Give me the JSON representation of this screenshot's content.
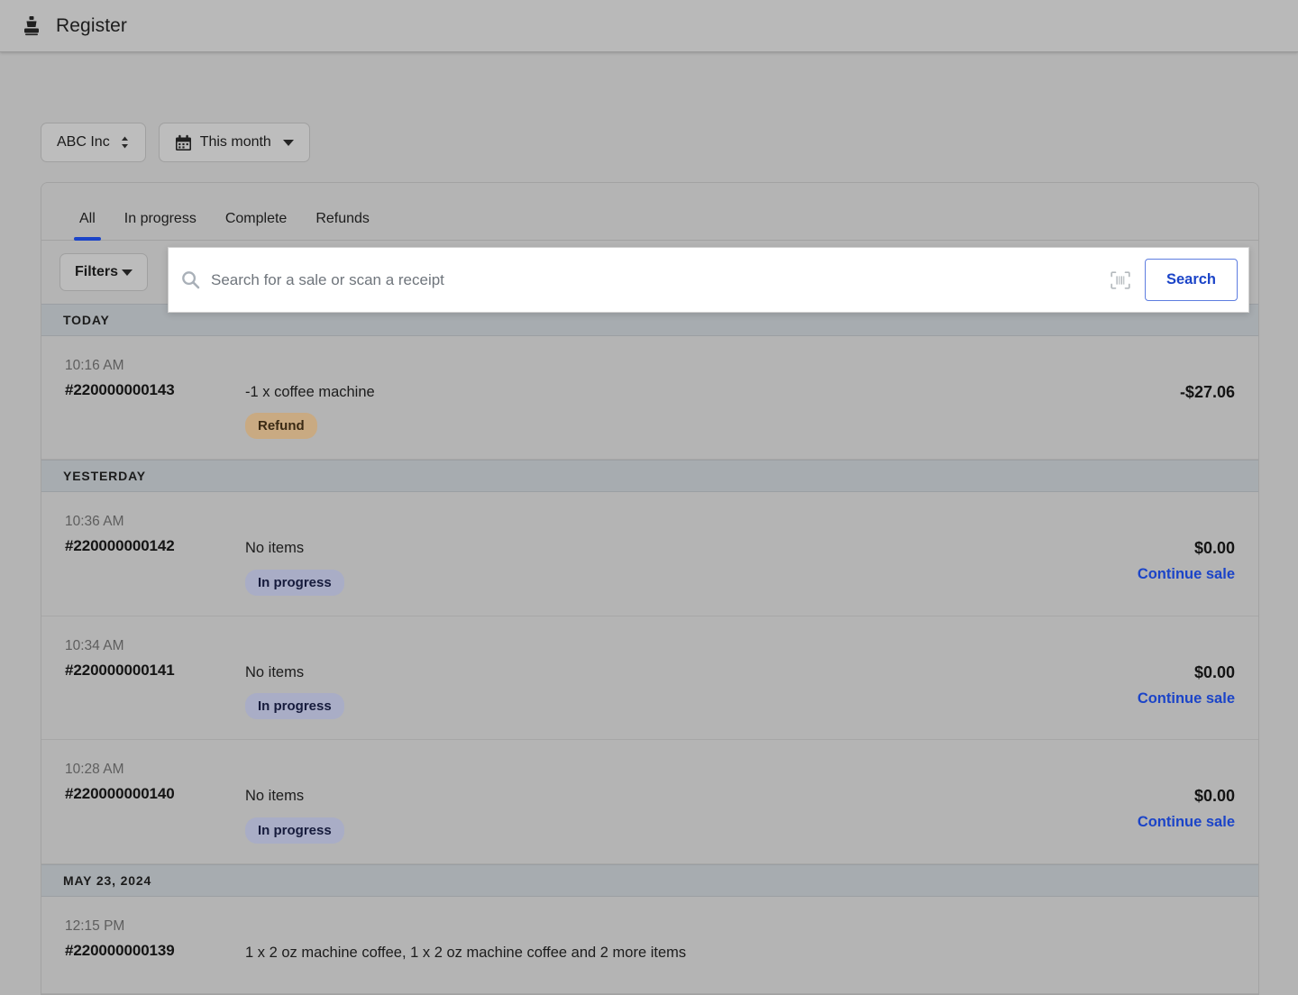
{
  "header": {
    "title": "Register",
    "icon": "register-stamp-icon"
  },
  "toolbar": {
    "entity": {
      "label": "ABC Inc",
      "icon": "up-down-chevron-icon"
    },
    "date_range": {
      "label": "This month",
      "icon": "calendar-icon",
      "caret": "chevron-down-icon"
    }
  },
  "tabs": [
    {
      "label": "All",
      "active": true
    },
    {
      "label": "In progress",
      "active": false
    },
    {
      "label": "Complete",
      "active": false
    },
    {
      "label": "Refunds",
      "active": false
    }
  ],
  "filters": {
    "label": "Filters",
    "caret": "chevron-down-icon"
  },
  "search": {
    "placeholder": "Search for a sale or scan a receipt",
    "value": "",
    "glass_icon": "search-icon",
    "barcode_icon": "barcode-scan-icon",
    "submit_label": "Search"
  },
  "accent_colors": {
    "link": "#1b44c8",
    "tab_underline": "#1b44c8",
    "refund_badge_bg": "#c9aa82",
    "inprogress_badge_bg": "#a9adc6",
    "day_header_bg": "#a7acb0",
    "card_bg": "#b4b4b4"
  },
  "groups": [
    {
      "day": "TODAY",
      "transactions": [
        {
          "time": "10:16 AM",
          "id": "#220000000143",
          "items": "-1 x coffee machine",
          "badge": "Refund",
          "badge_type": "refund",
          "amount": "-$27.06",
          "action": ""
        }
      ]
    },
    {
      "day": "YESTERDAY",
      "transactions": [
        {
          "time": "10:36 AM",
          "id": "#220000000142",
          "items": "No items",
          "badge": "In progress",
          "badge_type": "inprogress",
          "amount": "$0.00",
          "action": "Continue sale"
        },
        {
          "time": "10:34 AM",
          "id": "#220000000141",
          "items": "No items",
          "badge": "In progress",
          "badge_type": "inprogress",
          "amount": "$0.00",
          "action": "Continue sale"
        },
        {
          "time": "10:28 AM",
          "id": "#220000000140",
          "items": "No items",
          "badge": "In progress",
          "badge_type": "inprogress",
          "amount": "$0.00",
          "action": "Continue sale"
        }
      ]
    },
    {
      "day": "MAY 23, 2024",
      "transactions": [
        {
          "time": "12:15 PM",
          "id": "#220000000139",
          "items": "1 x 2 oz machine coffee, 1 x 2 oz machine coffee and 2 more items",
          "badge": "",
          "badge_type": "",
          "amount": "",
          "action": "",
          "clipped": true
        }
      ]
    }
  ]
}
